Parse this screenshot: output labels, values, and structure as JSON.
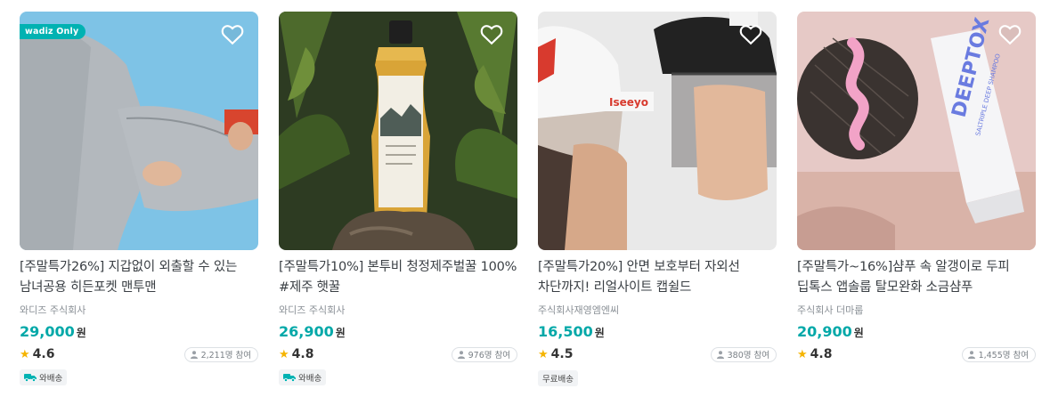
{
  "products": [
    {
      "image_desc": "gray hoodie sleeve with hidden pocket on blue background",
      "badge": "wadiz Only",
      "title": "[주말특가26%] 지갑없이 외출할 수 있는 남녀공용 히든포켓 맨투맨",
      "maker": "와디즈 주식회사",
      "price": "29,000",
      "currency": "원",
      "rating": "4.6",
      "participants": "2,211명 참여",
      "tag": "와배송",
      "tag_icon": "truck-icon"
    },
    {
      "image_desc": "honey bottle standing on soil among plants",
      "badge": "",
      "title": "[주말특가10%] 본투비 청정제주벌꿀 100% #제주 햇꿀",
      "maker": "와디즈 주식회사",
      "price": "26,900",
      "currency": "원",
      "rating": "4.8",
      "participants": "976명 참여",
      "tag": "와배송",
      "tag_icon": "truck-icon"
    },
    {
      "image_desc": "two people wearing caps with face shields",
      "badge": "",
      "title": "[주말특가20%] 안면 보호부터 자외선 차단까지! 리얼사이트 캡쉴드",
      "maker": "주식회사재영엠엔씨",
      "price": "16,500",
      "currency": "원",
      "rating": "4.5",
      "participants": "380명 참여",
      "tag": "무료배송",
      "tag_icon": ""
    },
    {
      "image_desc": "scalp shampoo tube DEEPTOX with pink cream",
      "badge": "",
      "title": "[주말특가~16%]샴푸 속 알갱이로 두피 딥톡스 앱솔룹 탈모완화 소금샴푸",
      "maker": "주식회사 더마룹",
      "price": "20,900",
      "currency": "원",
      "rating": "4.8",
      "participants": "1,455명 참여",
      "tag": "",
      "tag_icon": ""
    }
  ],
  "colors": {
    "price": "#00a8a8",
    "badge": "#00b2b2",
    "star": "#f5b400"
  }
}
